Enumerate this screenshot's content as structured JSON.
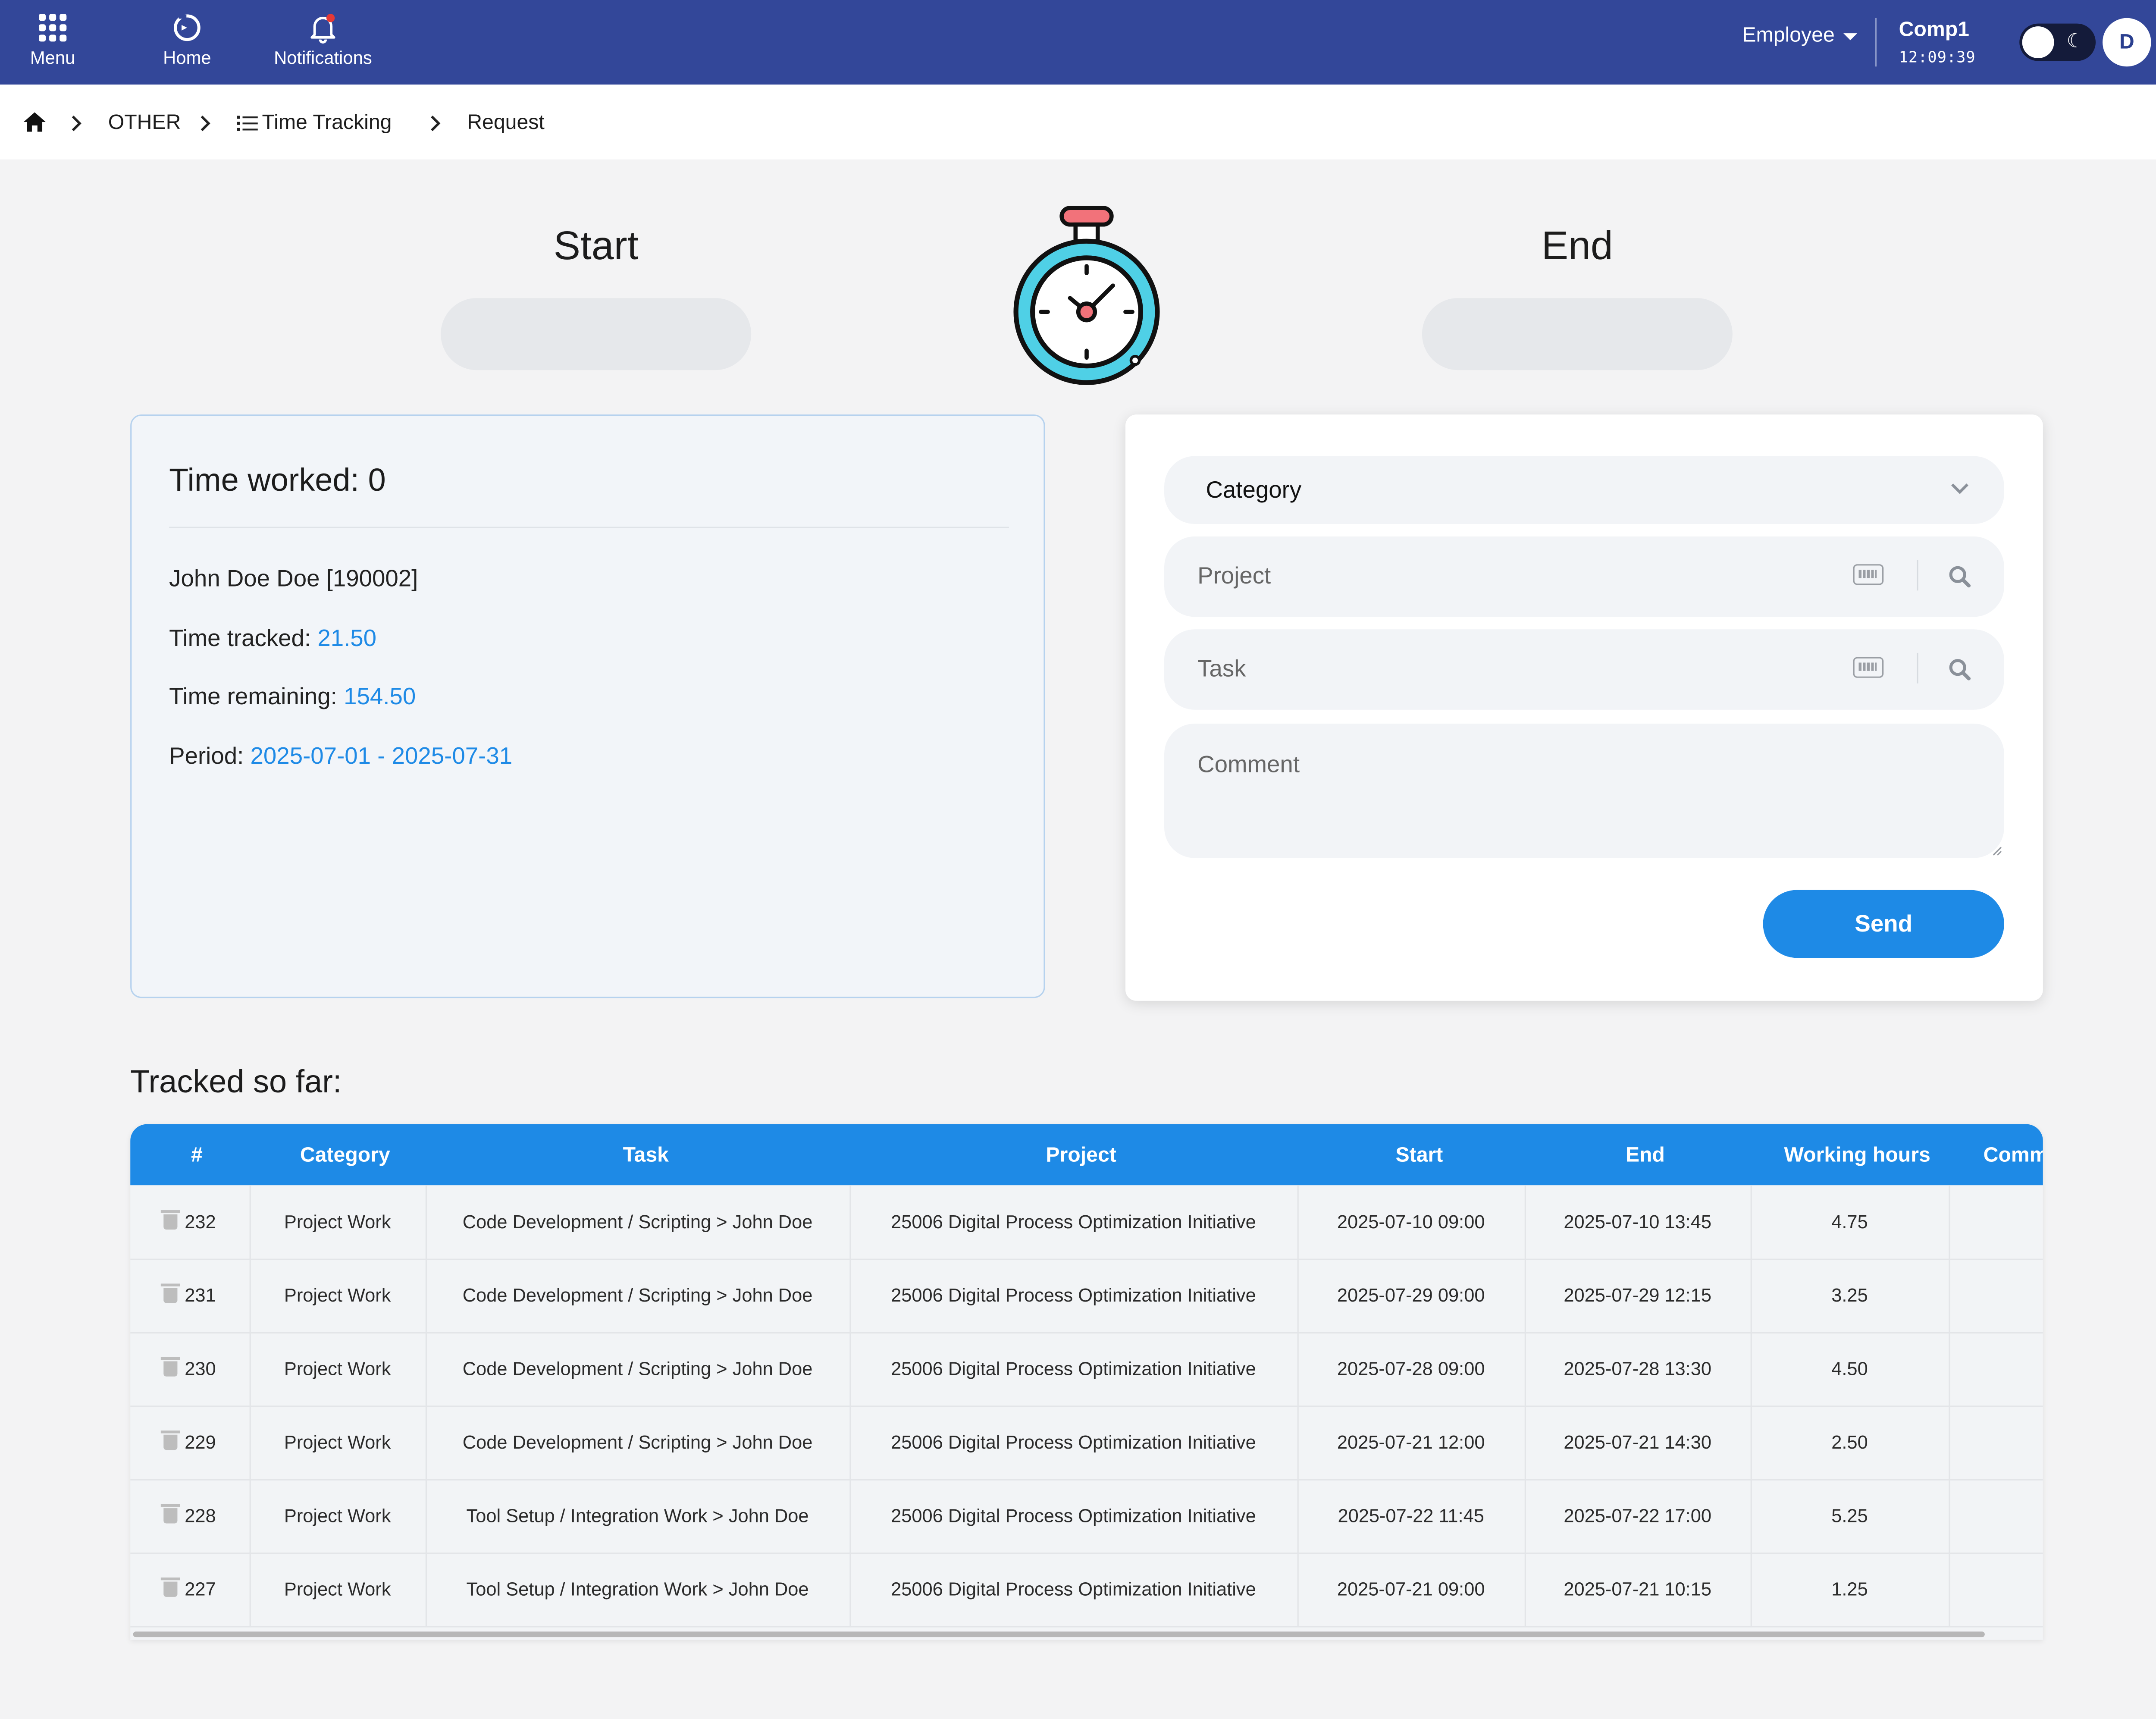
{
  "topbar": {
    "menu": "Menu",
    "home": "Home",
    "notifications": "Notifications",
    "role": "Employee",
    "company": "Comp1",
    "time": "12:09:39",
    "avatar_initial": "D"
  },
  "breadcrumb": {
    "other": "OTHER",
    "time_tracking": "Time Tracking",
    "request": "Request"
  },
  "tracker": {
    "start_label": "Start",
    "end_label": "End"
  },
  "info": {
    "title": "Time worked: 0",
    "employee": "John Doe Doe [190002]",
    "tracked_label": "Time tracked:",
    "tracked_value": "21.50",
    "remaining_label": "Time remaining:",
    "remaining_value": "154.50",
    "period_label": "Period:",
    "period_value": "2025-07-01 - 2025-07-31"
  },
  "form": {
    "category_label": "Category",
    "project_placeholder": "Project",
    "task_placeholder": "Task",
    "comment_placeholder": "Comment",
    "send_label": "Send"
  },
  "table": {
    "title": "Tracked so far:",
    "columns": [
      "#",
      "Category",
      "Task",
      "Project",
      "Start",
      "End",
      "Working hours",
      "Comm"
    ],
    "rows": [
      [
        "232",
        "Project Work",
        "Code Development / Scripting > John Doe",
        "25006 Digital Process Optimization Initiative",
        "2025-07-10 09:00",
        "2025-07-10 13:45",
        "4.75"
      ],
      [
        "231",
        "Project Work",
        "Code Development / Scripting > John Doe",
        "25006 Digital Process Optimization Initiative",
        "2025-07-29 09:00",
        "2025-07-29 12:15",
        "3.25"
      ],
      [
        "230",
        "Project Work",
        "Code Development / Scripting > John Doe",
        "25006 Digital Process Optimization Initiative",
        "2025-07-28 09:00",
        "2025-07-28 13:30",
        "4.50"
      ],
      [
        "229",
        "Project Work",
        "Code Development / Scripting > John Doe",
        "25006 Digital Process Optimization Initiative",
        "2025-07-21 12:00",
        "2025-07-21 14:30",
        "2.50"
      ],
      [
        "228",
        "Project Work",
        "Tool Setup / Integration Work > John Doe",
        "25006 Digital Process Optimization Initiative",
        "2025-07-22 11:45",
        "2025-07-22 17:00",
        "5.25"
      ],
      [
        "227",
        "Project Work",
        "Tool Setup / Integration Work > John Doe",
        "25006 Digital Process Optimization Initiative",
        "2025-07-21 09:00",
        "2025-07-21 10:15",
        "1.25"
      ]
    ]
  },
  "colors": {
    "topbar": "#334799",
    "accent": "#1e8ae6",
    "stopwatch_ring": "#4fd0e6",
    "stopwatch_button": "#f2727a"
  }
}
